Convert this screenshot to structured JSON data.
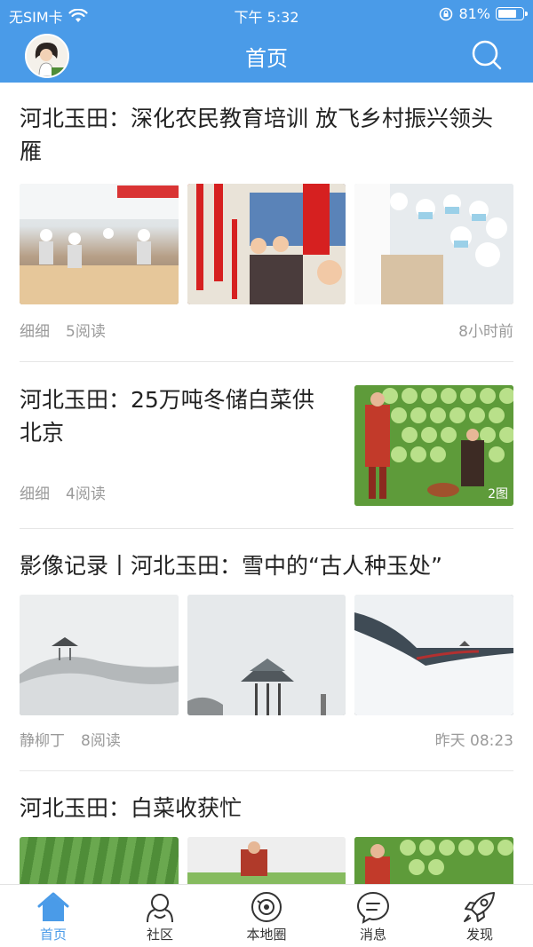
{
  "status_bar": {
    "carrier": "无SIM卡",
    "time": "下午 5:32",
    "battery": "81%",
    "battery_level": 0.81
  },
  "header": {
    "title": "首页"
  },
  "articles": [
    {
      "title": "河北玉田：深化农民教育培训 放飞乡村振兴领头雁",
      "author": "细细",
      "reads": "5阅读",
      "time": "8小时前"
    },
    {
      "title": "河北玉田：25万吨冬储白菜供北京",
      "author": "细细",
      "reads": "4阅读",
      "badge": "2图"
    },
    {
      "title": "影像记录丨河北玉田：雪中的“古人种玉处”",
      "author": "静柳丁",
      "reads": "8阅读",
      "time": "昨天 08:23"
    },
    {
      "title": "河北玉田：白菜收获忙"
    }
  ],
  "tabbar": {
    "active_color": "#4a9be8",
    "items": [
      {
        "label": "首页",
        "icon": "home-icon"
      },
      {
        "label": "社区",
        "icon": "community-icon"
      },
      {
        "label": "本地圈",
        "icon": "local-circle-icon"
      },
      {
        "label": "消息",
        "icon": "message-icon"
      },
      {
        "label": "发现",
        "icon": "rocket-icon"
      }
    ]
  }
}
